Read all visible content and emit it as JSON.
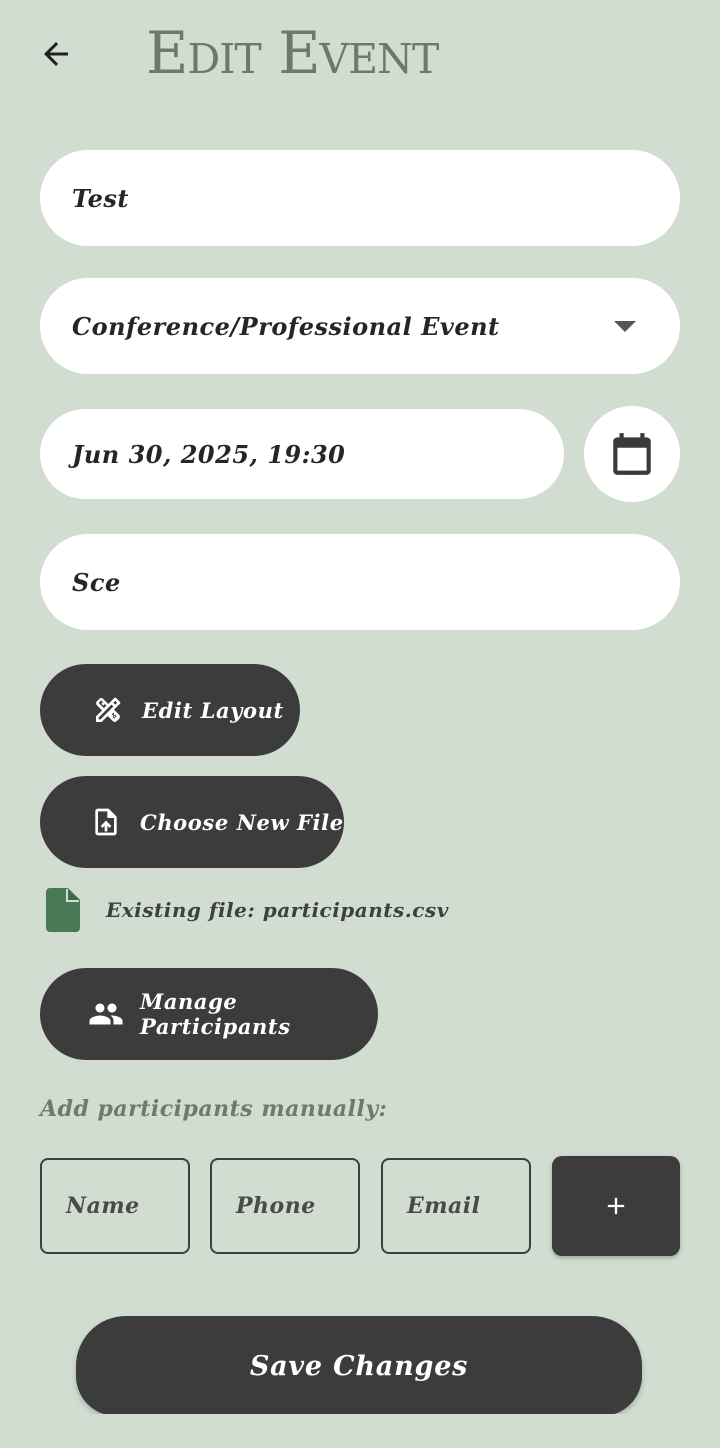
{
  "header": {
    "back_icon": "arrow-left-icon",
    "title": "Edit Event"
  },
  "form": {
    "event_name": "Test",
    "event_type": "Conference/Professional Event",
    "date_time": "Jun 30, 2025, 19:30",
    "calendar_icon": "calendar-icon",
    "location": "Sce"
  },
  "actions": {
    "edit_layout_label": "Edit Layout",
    "edit_layout_icon": "design-tools-icon",
    "choose_file_label": "Choose New File",
    "choose_file_icon": "file-upload-icon",
    "existing_file_label": "Existing file: participants.csv",
    "existing_file_icon": "file-icon",
    "manage_participants_label": "Manage Participants",
    "manage_participants_icon": "people-icon"
  },
  "manual": {
    "label": "Add participants manually:",
    "name_placeholder": "Name",
    "phone_placeholder": "Phone",
    "email_placeholder": "Email",
    "add_icon": "plus-icon"
  },
  "footer": {
    "save_label": "Save Changes"
  },
  "colors": {
    "background": "#d1ddd1",
    "dark_button": "#3c3c3c",
    "title": "#6b7a6b",
    "file_icon": "#4a7a55"
  }
}
